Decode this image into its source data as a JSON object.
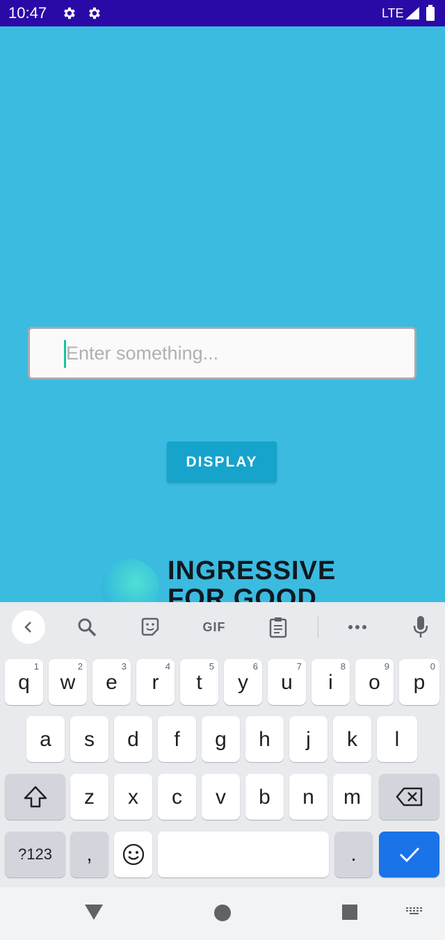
{
  "status_bar": {
    "time": "10:47",
    "network": "LTE",
    "icons": [
      "settings-gear-icon",
      "settings-gear-icon",
      "signal-icon",
      "battery-icon"
    ]
  },
  "main": {
    "input_placeholder": "Enter something...",
    "button_label": "DISPLAY",
    "logo_line1": "INGRESSIVE",
    "logo_line2": "FOR GOOD"
  },
  "keyboard": {
    "toolbar_icons": [
      "back-chevron-icon",
      "search-icon",
      "sticker-icon",
      "gif-icon",
      "clipboard-icon",
      "more-icon",
      "microphone-icon"
    ],
    "gif_label": "GIF",
    "row1": [
      {
        "k": "q",
        "h": "1"
      },
      {
        "k": "w",
        "h": "2"
      },
      {
        "k": "e",
        "h": "3"
      },
      {
        "k": "r",
        "h": "4"
      },
      {
        "k": "t",
        "h": "5"
      },
      {
        "k": "y",
        "h": "6"
      },
      {
        "k": "u",
        "h": "7"
      },
      {
        "k": "i",
        "h": "8"
      },
      {
        "k": "o",
        "h": "9"
      },
      {
        "k": "p",
        "h": "0"
      }
    ],
    "row2": [
      "a",
      "s",
      "d",
      "f",
      "g",
      "h",
      "j",
      "k",
      "l"
    ],
    "row3": [
      "z",
      "x",
      "c",
      "v",
      "b",
      "n",
      "m"
    ],
    "symbols_label": "?123",
    "comma": ",",
    "period": "."
  },
  "colors": {
    "app_background": "#3bbbe0",
    "status_bar": "#2a0aa6",
    "button": "#16a3cc",
    "caret": "#16c2a0",
    "enter_key": "#1a73e8"
  }
}
